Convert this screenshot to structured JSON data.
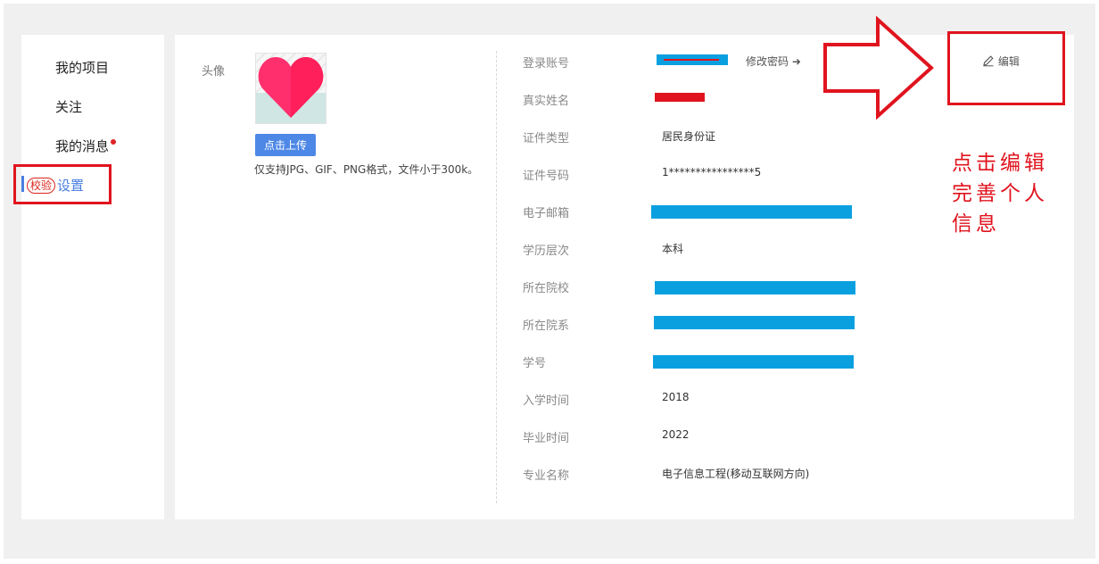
{
  "sidebar": {
    "items": [
      {
        "label": "我的项目"
      },
      {
        "label": "关注"
      },
      {
        "label": "我的消息"
      },
      {
        "label": "设置",
        "badge": "校验",
        "active": true
      }
    ]
  },
  "avatar": {
    "label": "头像",
    "upload_button": "点击上传",
    "hint": "仅支持JPG、GIF、PNG格式，文件小于300k。"
  },
  "profile": {
    "change_password": "修改密码 ➜",
    "edit_label": "编辑",
    "fields": [
      {
        "label": "登录账号",
        "value": ""
      },
      {
        "label": "真实姓名",
        "value": ""
      },
      {
        "label": "证件类型",
        "value": "居民身份证"
      },
      {
        "label": "证件号码",
        "value": "1****************5"
      },
      {
        "label": "电子邮箱",
        "value": ""
      },
      {
        "label": "学历层次",
        "value": "本科"
      },
      {
        "label": "所在院校",
        "value": ""
      },
      {
        "label": "所在院系",
        "value": ""
      },
      {
        "label": "学号",
        "value": ""
      },
      {
        "label": "入学时间",
        "value": "2018"
      },
      {
        "label": "毕业时间",
        "value": "2022"
      },
      {
        "label": "专业名称",
        "value": "电子信息工程(移动互联网方向)"
      }
    ]
  },
  "annotation": {
    "note_line1": "点击编辑",
    "note_line2": "完善个人",
    "note_line3": "信息"
  },
  "colors": {
    "accent": "#4a7ee0",
    "annotation_red": "#e0141e",
    "redaction_blue": "#0aa0e0",
    "background": "#f0f0f0"
  },
  "icons": [
    "heart-icon",
    "pencil-icon",
    "arrow-right-icon",
    "red-dot-icon"
  ]
}
